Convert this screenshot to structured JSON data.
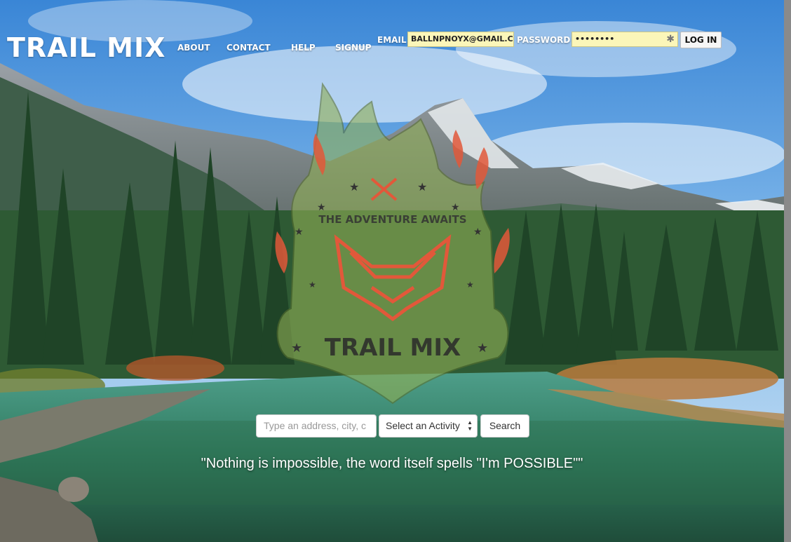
{
  "brand": {
    "title": "TRAIL MIX"
  },
  "nav": {
    "items": [
      {
        "label": "ABOUT"
      },
      {
        "label": "CONTACT"
      },
      {
        "label": "HELP"
      },
      {
        "label": "SIGNUP"
      }
    ]
  },
  "login": {
    "email_label": "EMAIL",
    "email_value": "BALLNPNOYX@GMAIL.C",
    "password_label": "PASSWORD",
    "password_value": "••••••••",
    "button_label": "LOG IN"
  },
  "logo": {
    "tagline": "THE ADVENTURE AWAITS",
    "name": "TRAIL MIX",
    "icons": [
      "crossed-axes-icon",
      "fox-icon",
      "star-icon",
      "flame-icon"
    ]
  },
  "search": {
    "placeholder": "Type an address, city, c",
    "activity_selected": "Select an Activity",
    "button_label": "Search"
  },
  "quote": "\"Nothing is impossible, the word itself spells \"I'm POSSIBLE\"\"",
  "colors": {
    "input_highlight": "#fbf6b9",
    "logo_green": "#8fae55",
    "logo_orange": "#e2583a"
  }
}
